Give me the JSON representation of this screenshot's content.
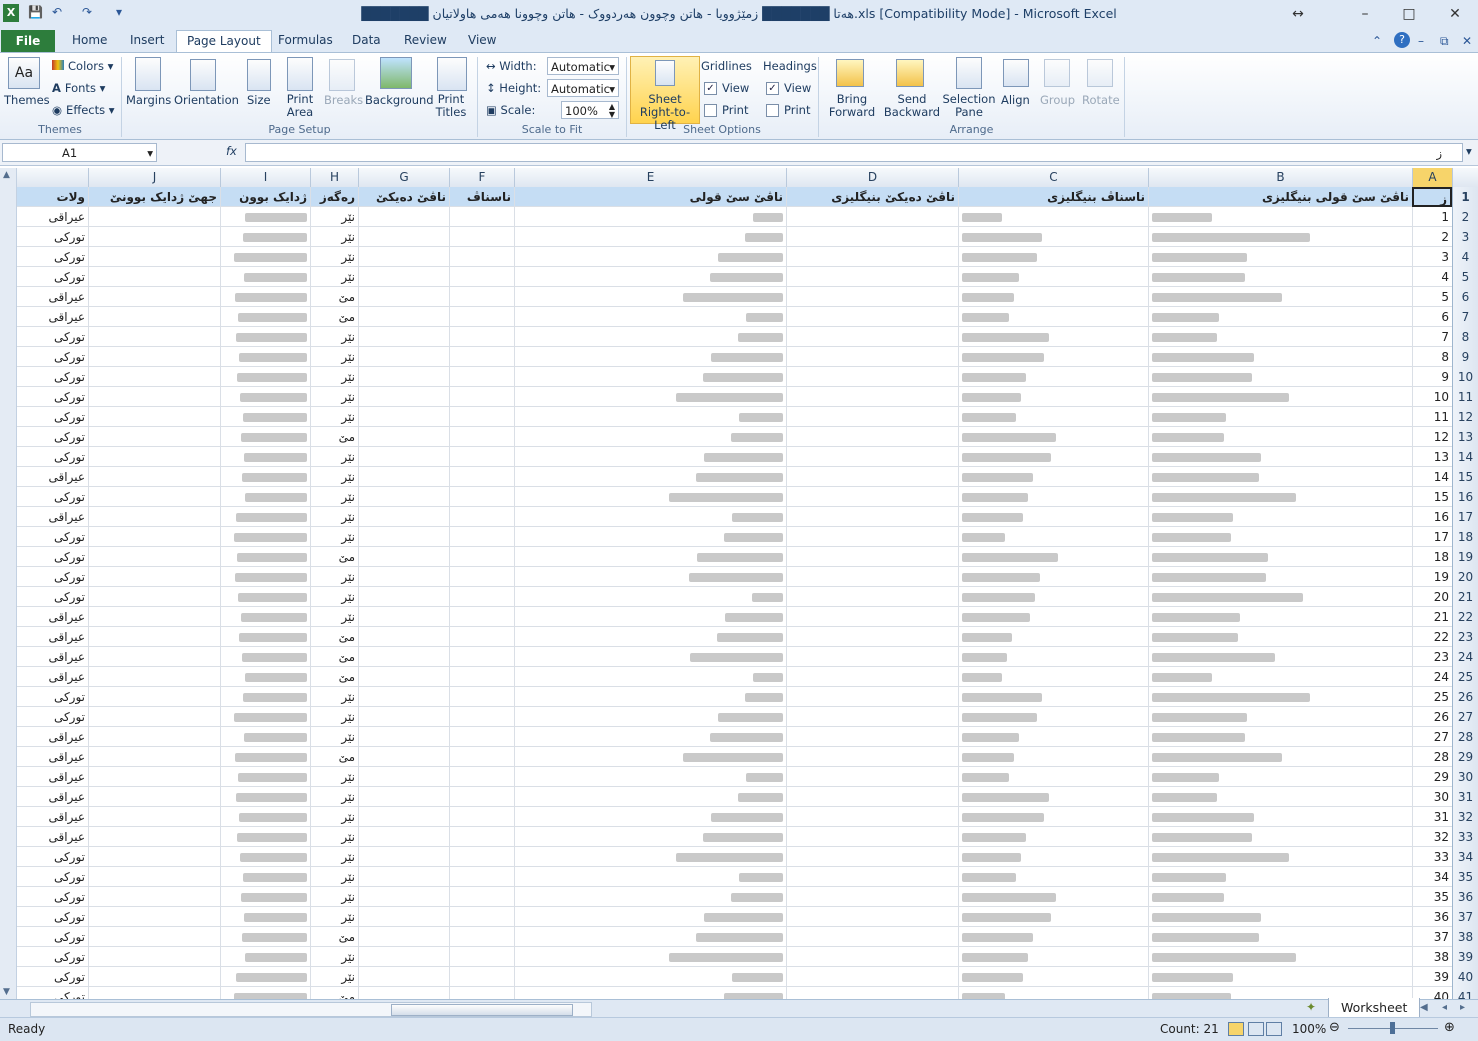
{
  "window": {
    "title": "███████ هەتا ███████ زمێژوویا - هاتن وچوون هەردووک - هاتن وچوونا هەمی هاولاتیان.xls  [Compatibility Mode] - Microsoft Excel",
    "app_icon": "excel-icon"
  },
  "tabs": [
    "Home",
    "Insert",
    "Page Layout",
    "Formulas",
    "Data",
    "Review",
    "View"
  ],
  "file_tab": "File",
  "active_tab": "Page Layout",
  "ribbon": {
    "themes": {
      "themes": "Themes",
      "colors": "Colors",
      "fonts": "Fonts",
      "effects": "Effects",
      "group": "Themes"
    },
    "page_setup": {
      "margins": "Margins",
      "orientation": "Orientation",
      "size": "Size",
      "print_area": "Print Area",
      "breaks": "Breaks",
      "background": "Background",
      "print_titles": "Print Titles",
      "group": "Page Setup"
    },
    "scale": {
      "width_label": "Width:",
      "width_value": "Automatic",
      "height_label": "Height:",
      "height_value": "Automatic",
      "scale_label": "Scale:",
      "scale_value": "100%",
      "group": "Scale to Fit"
    },
    "sheet_options": {
      "rtl": "Sheet Right-to-Left",
      "gridlines": "Gridlines",
      "headings": "Headings",
      "view": "View",
      "print": "Print",
      "group": "Sheet Options"
    },
    "arrange": {
      "bring_forward": "Bring Forward",
      "send_backward": "Send Backward",
      "selection_pane": "Selection Pane",
      "align": "Align",
      "group_btn": "Group",
      "rotate": "Rotate",
      "group": "Arrange"
    }
  },
  "formula_bar": {
    "name_box": "A1",
    "fx": "fx",
    "content": "ز"
  },
  "columns": [
    "A",
    "B",
    "C",
    "D",
    "E",
    "F",
    "G",
    "H",
    "I",
    "J"
  ],
  "header_row": {
    "A": "ز",
    "B": "ناڤێ سێ قولی بنیگلیزی",
    "C": "ناسناڤ بنیگلیزی",
    "D": "ناڤێ دەیکێ بنیگلیزی",
    "E": "ناڤێ سێ قولی",
    "F": "ناسناڤ",
    "G": "ناڤێ دەیکێ",
    "H": "رەگەز",
    "I": "ژدایک بوون",
    "J": "جهێ ژدایک بوونێ",
    "K": "ولات"
  },
  "rows": [
    {
      "n": "1",
      "gender": "نێر",
      "country": "عیراقی"
    },
    {
      "n": "2",
      "gender": "نێر",
      "country": "تورکی"
    },
    {
      "n": "3",
      "gender": "نێر",
      "country": "تورکی"
    },
    {
      "n": "4",
      "gender": "نێر",
      "country": "تورکی"
    },
    {
      "n": "5",
      "gender": "مێ",
      "country": "عیراقی"
    },
    {
      "n": "6",
      "gender": "مێ",
      "country": "عیراقی"
    },
    {
      "n": "7",
      "gender": "نێر",
      "country": "تورکی"
    },
    {
      "n": "8",
      "gender": "نێر",
      "country": "تورکی"
    },
    {
      "n": "9",
      "gender": "نێر",
      "country": "تورکی"
    },
    {
      "n": "10",
      "gender": "نێر",
      "country": "تورکی"
    },
    {
      "n": "11",
      "gender": "نێر",
      "country": "تورکی"
    },
    {
      "n": "12",
      "gender": "مێ",
      "country": "تورکی"
    },
    {
      "n": "13",
      "gender": "نێر",
      "country": "تورکی"
    },
    {
      "n": "14",
      "gender": "نێر",
      "country": "عیراقی"
    },
    {
      "n": "15",
      "gender": "نێر",
      "country": "تورکی"
    },
    {
      "n": "16",
      "gender": "نێر",
      "country": "عیراقی"
    },
    {
      "n": "17",
      "gender": "نێر",
      "country": "تورکی"
    },
    {
      "n": "18",
      "gender": "مێ",
      "country": "تورکی"
    },
    {
      "n": "19",
      "gender": "نێر",
      "country": "تورکی"
    },
    {
      "n": "20",
      "gender": "نێر",
      "country": "تورکی"
    },
    {
      "n": "21",
      "gender": "نێر",
      "country": "عیراقی"
    },
    {
      "n": "22",
      "gender": "مێ",
      "country": "عیراقی"
    },
    {
      "n": "23",
      "gender": "مێ",
      "country": "عیراقی"
    },
    {
      "n": "24",
      "gender": "مێ",
      "country": "عیراقی"
    },
    {
      "n": "25",
      "gender": "نێر",
      "country": "تورکی"
    },
    {
      "n": "26",
      "gender": "نێر",
      "country": "تورکی"
    },
    {
      "n": "27",
      "gender": "نێر",
      "country": "عیراقی"
    },
    {
      "n": "28",
      "gender": "مێ",
      "country": "عیراقی"
    },
    {
      "n": "29",
      "gender": "نێر",
      "country": "عیراقی"
    },
    {
      "n": "30",
      "gender": "نێر",
      "country": "عیراقی"
    },
    {
      "n": "31",
      "gender": "نێر",
      "country": "عیراقی"
    },
    {
      "n": "32",
      "gender": "نێر",
      "country": "عیراقی"
    },
    {
      "n": "33",
      "gender": "نێر",
      "country": "تورکی"
    },
    {
      "n": "34",
      "gender": "نێر",
      "country": "تورکی"
    },
    {
      "n": "35",
      "gender": "نێر",
      "country": "تورکی"
    },
    {
      "n": "36",
      "gender": "نێر",
      "country": "تورکی"
    },
    {
      "n": "37",
      "gender": "مێ",
      "country": "تورکی"
    },
    {
      "n": "38",
      "gender": "نێر",
      "country": "تورکی"
    },
    {
      "n": "39",
      "gender": "نێر",
      "country": "تورکی"
    },
    {
      "n": "40",
      "gender": "مێ",
      "country": "تورکی"
    }
  ],
  "row_numbers_start": 1,
  "sheet_tab": "Worksheet",
  "status": {
    "ready": "Ready",
    "count": "Count: 21",
    "zoom": "100%"
  },
  "colors": {
    "excel_green": "#2d7d3c",
    "header_fill": "#c5ddf4",
    "ribbon_blue": "#dfe9f5"
  }
}
